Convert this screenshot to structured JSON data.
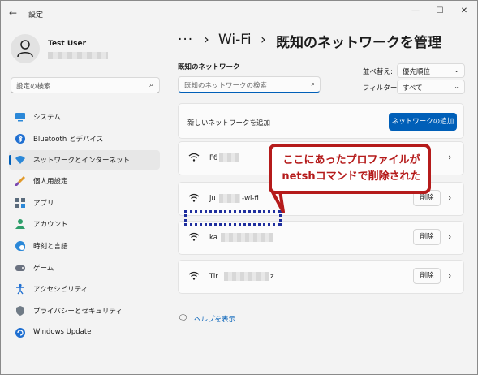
{
  "window": {
    "title": "設定",
    "back_glyph": "←",
    "minimize_glyph": "—",
    "maximize_glyph": "☐",
    "close_glyph": "✕"
  },
  "profile": {
    "name": "Test User"
  },
  "sidebar": {
    "search_placeholder": "設定の検索",
    "items": [
      {
        "label": "システム",
        "icon": "system-icon",
        "active": false
      },
      {
        "label": "Bluetooth とデバイス",
        "icon": "bluetooth-icon",
        "active": false
      },
      {
        "label": "ネットワークとインターネット",
        "icon": "network-icon",
        "active": true
      },
      {
        "label": "個人用設定",
        "icon": "brush-icon",
        "active": false
      },
      {
        "label": "アプリ",
        "icon": "apps-icon",
        "active": false
      },
      {
        "label": "アカウント",
        "icon": "account-icon",
        "active": false
      },
      {
        "label": "時刻と言語",
        "icon": "globe-clock-icon",
        "active": false
      },
      {
        "label": "ゲーム",
        "icon": "gamepad-icon",
        "active": false
      },
      {
        "label": "アクセシビリティ",
        "icon": "accessibility-icon",
        "active": false
      },
      {
        "label": "プライバシーとセキュリティ",
        "icon": "shield-icon",
        "active": false
      },
      {
        "label": "Windows Update",
        "icon": "update-icon",
        "active": false
      }
    ]
  },
  "header": {
    "ellipsis": "···",
    "sep1": "›",
    "parent": "Wi-Fi",
    "sep2": "›",
    "title": "既知のネットワークを管理"
  },
  "known": {
    "label": "既知のネットワーク",
    "search_placeholder": "既知のネットワークの検索",
    "sort_label": "並べ替え:",
    "sort_value": "優先順位",
    "filter_label": "フィルター:",
    "filter_value": "すべて",
    "add_text": "新しいネットワークを追加",
    "add_button": "ネットワークの追加",
    "delete_label": "削除",
    "networks": [
      {
        "name": "F6",
        "suffix": ""
      },
      {
        "name": "ju",
        "suffix": "-wi-fi"
      },
      {
        "name": "ka",
        "suffix": ""
      },
      {
        "name": "Tir",
        "suffix": "z"
      }
    ]
  },
  "help": {
    "text": "ヘルプを表示"
  },
  "annotation": {
    "line1": "ここにあったプロファイルが",
    "line2": "netshコマンドで削除された"
  },
  "colors": {
    "accent": "#005fb8",
    "annotation": "#b51b1b",
    "dotted": "#1e2e9e"
  }
}
